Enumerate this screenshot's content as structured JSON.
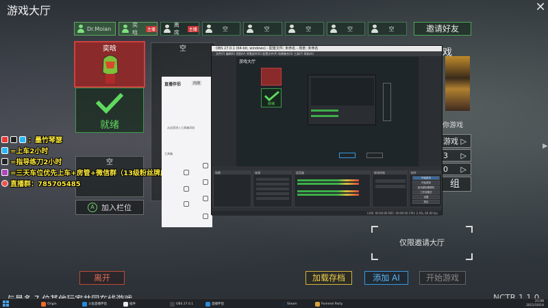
{
  "header": {
    "title": "游戏大厅",
    "close_symbol": "✕"
  },
  "slots": [
    {
      "name": "Dr.Moian",
      "filled": true,
      "tag": ""
    },
    {
      "name": "奕晗",
      "filled": true,
      "tag": "主播"
    },
    {
      "name": "离席",
      "filled": false,
      "tag": "主播"
    },
    {
      "name": "空",
      "filled": false,
      "tag": ""
    },
    {
      "name": "空",
      "filled": false,
      "tag": ""
    },
    {
      "name": "空",
      "filled": false,
      "tag": ""
    },
    {
      "name": "空",
      "filled": false,
      "tag": ""
    },
    {
      "name": "空",
      "filled": false,
      "tag": ""
    }
  ],
  "invite_label": "邀请好友",
  "player1": {
    "name": "奕晗"
  },
  "ready_label": "就绪",
  "empty_card_label": "空",
  "join_label": "加入栏位",
  "join_key": "A",
  "card2_label": "空",
  "overlay": [
    {
      "icon": "red",
      "text": "：墨竹琴瑟"
    },
    {
      "icon": "blue",
      "text": "=上车2小时"
    },
    {
      "icon": "teal",
      "text": "=指导练刀2小时"
    },
    {
      "icon": "pink",
      "text": "=三天车位优先上车+房管+微信群（13级粉丝牌房管）"
    },
    {
      "icon": "white",
      "text": "直播群：785705485"
    }
  ],
  "right_panel": {
    "text_mid": "你游戏",
    "row_game": "游戏",
    "row_3": "3",
    "row_0": "0",
    "group": "组",
    "lobby_note": "仅限邀请大厅",
    "arrow": "▷"
  },
  "buttons": {
    "leave": "离开",
    "load": "加载存档",
    "add_ai": "添加 AI",
    "start": "开始游戏"
  },
  "ticker": "与最多 7 位其他玩家共同在线游戏",
  "ticker_right": "NCTR 1 1 0",
  "assistant": {
    "brand": "直播伴侣",
    "version": "内测",
    "side_labels": [
      "工具箱"
    ],
    "hint": "从这里进入工具箱添加"
  },
  "obs": {
    "title": "OBS 27.0.1 (64-bit, windows) - 配置文件: 未命名 - 场景: 未命名",
    "menu": "文件(F)  编辑(E)  视图(V)  停靠部件(D)  配置文件(P)  场景集合(S)  工具(T)  帮助(H)",
    "docks": [
      "场景",
      "来源",
      "混音器",
      "转场特效",
      "控件"
    ],
    "controls": [
      "开始推流",
      "开始录制",
      "启动虚拟摄像机",
      "工作室模式",
      "设置",
      "退出"
    ],
    "status": "LIVE: 00:00:00  REC: 00:00:00  CPU: 2.4%, 60.00 fps",
    "preview_title": "游戏大厅",
    "preview_ready": "就绪"
  },
  "taskbar": {
    "items": [
      "Origin",
      "斗鱼直播伴侣",
      "插件",
      "OBS 27.0.1",
      "直播伴侣",
      "Steam",
      "Pummel Party"
    ],
    "clock_time": "21:08",
    "clock_date": "2021/10/14"
  }
}
